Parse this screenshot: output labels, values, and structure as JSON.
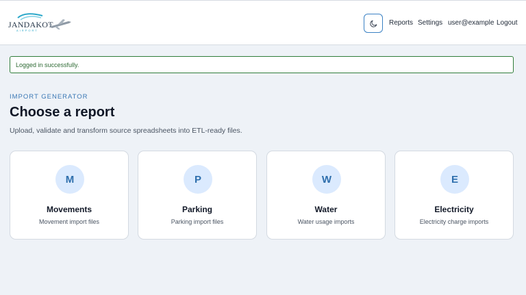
{
  "header": {
    "logo": {
      "text": "JANDAKOT",
      "subtext": "AIRPORT"
    },
    "theme_toggle_icon": "moon-icon",
    "nav": {
      "reports": "Reports",
      "settings": "Settings",
      "user": "user@example",
      "logout": "Logout"
    }
  },
  "alert": {
    "message": "Logged in successfully.",
    "color": "#2f7d3a"
  },
  "main": {
    "eyebrow": "IMPORT GENERATOR",
    "title": "Choose a report",
    "subtitle": "Upload, validate and transform source spreadsheets into ETL-ready files.",
    "cards": [
      {
        "letter": "M",
        "title": "Movements",
        "description": "Movement import files"
      },
      {
        "letter": "P",
        "title": "Parking",
        "description": "Parking import files"
      },
      {
        "letter": "W",
        "title": "Water",
        "description": "Water usage imports"
      },
      {
        "letter": "E",
        "title": "Electricity",
        "description": "Electricity charge imports"
      }
    ]
  },
  "colors": {
    "accent": "#3b82c4",
    "badge_bg": "#dbeafe",
    "page_bg": "#eef2f7"
  }
}
